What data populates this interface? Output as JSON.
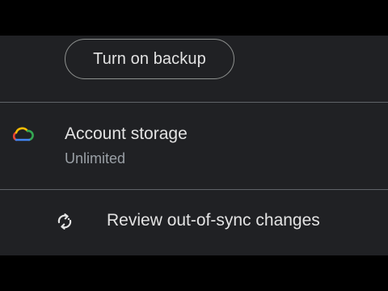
{
  "backup": {
    "button_label": "Turn on backup"
  },
  "account_storage": {
    "title": "Account storage",
    "subtitle": "Unlimited",
    "icon": "cloud-icon"
  },
  "sync": {
    "label": "Review out-of-sync changes",
    "icon": "sync-icon"
  },
  "colors": {
    "panel_background": "#202124",
    "page_background": "#000000",
    "text_primary": "#e3e3e3",
    "text_secondary": "#9aa0a6",
    "divider": "#5f6368",
    "cloud_blue": "#4285f4",
    "cloud_red": "#ea4335",
    "cloud_yellow": "#fbbc04",
    "cloud_green": "#34a853"
  }
}
